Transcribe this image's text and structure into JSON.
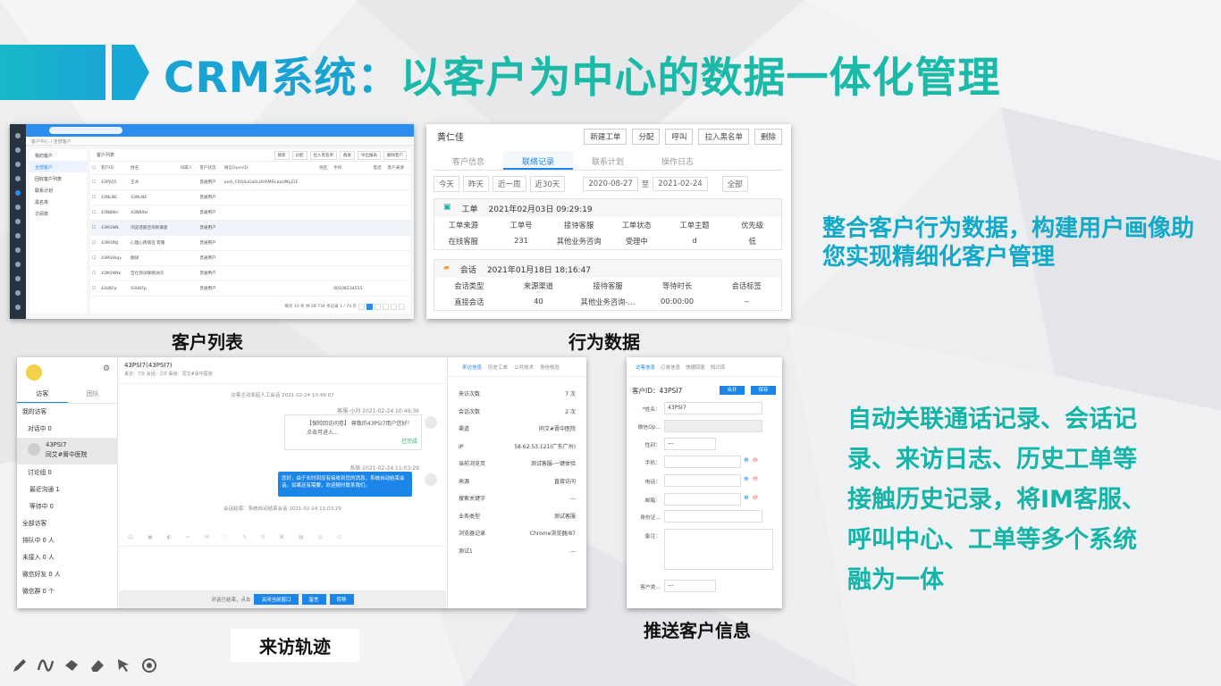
{
  "title": {
    "part1": "CRM系统：",
    "part2": "以客户为中心的数据一体化管理"
  },
  "right_text_1": "整合客户行为数据，构建用户画像助您实现精细化客户管理",
  "right_text_2": "自动关联通话记录、会话记录、来访日志、历史工单等接触历史记录，将IM客服、呼叫中心、工单等多个系统融为一体",
  "captions": {
    "customer_list": "客户列表",
    "behavior": "行为数据",
    "visit_track": "来访轨迹",
    "push_info": "推送客户信息"
  },
  "customer_list": {
    "breadcrumb": "客户中心 / 全部客户",
    "nav": [
      "我的客户",
      "全部客户",
      "回收客户列表",
      "联系计划",
      "黑名单",
      "订阅单"
    ],
    "list_title": "客户列表",
    "toolbar": [
      "搜索",
      "分配",
      "拉入黑名单",
      "群发",
      "导出报表",
      "删除客户"
    ],
    "columns": [
      "客户ID",
      "姓名",
      "归属人",
      "客户状态",
      "微信OpenID",
      "地区",
      "手机",
      "电话",
      "客户来源"
    ],
    "rows": [
      [
        "43PJVj5",
        "王水",
        "",
        "普通用户",
        "ozrh_F0Q4uGahLOHhMFicaaUfKyZrE",
        "",
        "",
        "",
        ""
      ],
      [
        "43NLNE",
        "43NLNE",
        "",
        "普通用户",
        "",
        "",
        "",
        "",
        ""
      ],
      [
        "43NB9kr",
        "43NB9kr",
        "",
        "普通用户",
        "",
        "",
        "",
        "",
        ""
      ],
      [
        "43M1NN",
        "浏览话题咨询到满意",
        "",
        "普通用户",
        "",
        "",
        "",
        "",
        ""
      ],
      [
        "43M1fNJ",
        "心理心疾病咨 客服",
        "",
        "普通用户",
        "",
        "",
        "",
        "",
        ""
      ],
      [
        "43M3Hlqv",
        "翻译",
        "",
        "普通用户",
        "",
        "",
        "",
        "",
        ""
      ],
      [
        "43M1NNk",
        "吉仕测试联络访问",
        "",
        "普通用户",
        "",
        "",
        "",
        "",
        ""
      ],
      [
        "43UKFp",
        "43UKFp",
        "",
        "普通用户",
        "",
        "",
        "00108234553",
        "",
        ""
      ]
    ],
    "pager": "每页 10 条 共 28 734 条记录  1 / 74 页"
  },
  "behavior": {
    "name": "黄仁佳",
    "buttons": [
      "新建工单",
      "分配",
      "呼叫",
      "拉入黑名单",
      "删除"
    ],
    "tabs": [
      "客户信息",
      "联络记录",
      "联系计划",
      "操作日志"
    ],
    "active_tab": "联络记录",
    "filters": [
      "今天",
      "昨天",
      "近一周",
      "近30天"
    ],
    "date_from": "2020-08-27",
    "date_sep": "至",
    "date_to": "2021-02-24",
    "scope": "全部",
    "card1": {
      "type": "工单",
      "time": "2021年02月03日 09:29:19",
      "headers": [
        "工单来源",
        "工单号",
        "接待客服",
        "工单状态",
        "工单主题",
        "优先级"
      ],
      "values": [
        "在线客服",
        "231",
        "其他业务咨询",
        "受理中",
        "d",
        "低"
      ]
    },
    "card2": {
      "type": "会话",
      "time": "2021年01月18日 18:16:47",
      "headers": [
        "会话类型",
        "来源渠道",
        "接待客服",
        "等待时长",
        "会话标签"
      ],
      "values": [
        "直接会话",
        "40",
        "其他业务咨询-...",
        "00:00:00",
        "--"
      ]
    }
  },
  "visit": {
    "tabs": [
      "访客",
      "团队"
    ],
    "list": [
      "我的访客",
      "对话中 0",
      "43PSI7\n同艾#膏中医院",
      "讨论组 0",
      "最近沟通 1",
      "等待中 0",
      "全部访客",
      "排队中 0 人",
      "未接入 0 人",
      "微信好友 0 人",
      "微信群 0 个"
    ],
    "header_title": "43PSI7(43PSI7)",
    "header_sub": "来访：7次 会话：2次 渠道：同艾#膏中医院",
    "sys1": "访客主动发起人工会话 2021-02-24 10:49:07",
    "who1": "客服-小刘  2021-02-24 10:49:36",
    "bubble1": "【保险回访问卷】 尊敬的43PSI7用户您好！点击可进入...",
    "bubble1_status": "已完成",
    "who2": "系统  2021-02-24 11:03:29",
    "bubble2": "您好，由于长时间没有接收到您的消息，系统自动结束会话。如果还有需要，欢迎随时联系我们。",
    "sys2": "会话结束：系统自动结束会话 2021-02-24 11:03:29",
    "tools": "☺ ▣ ◐ ✂ ✉ ♡ ✎ ⚲ ⌘ ▤ ◎ ⊙",
    "bottom": "对话已结束，点击",
    "bottom_btns": [
      "关闭当前窗口",
      "留言",
      "转移"
    ],
    "right_tabs": [
      "来访信息",
      "历史工单",
      "公共技术",
      "身份核验"
    ],
    "info": [
      [
        "来访次数",
        "7 次"
      ],
      [
        "会话次数",
        "2 次"
      ],
      [
        "渠道",
        "同艾#膏中医院"
      ],
      [
        "IP",
        "58.62.53.121(广东广州)"
      ],
      [
        "当前浏览页",
        "测试客服-一键体验"
      ],
      [
        "来源",
        "直接访问"
      ],
      [
        "搜索关键字",
        "---"
      ],
      [
        "业务类型",
        "测试客服"
      ],
      [
        "浏览器记录",
        "Chrome浏览器/87"
      ],
      [
        "测试1",
        "---"
      ]
    ]
  },
  "push": {
    "tabs": [
      "访客信息",
      "订单信息",
      "快捷回复",
      "知识库"
    ],
    "id_label": "客户ID：43PSI7",
    "btn_merge": "合并",
    "btn_save": "保存",
    "fields": [
      {
        "label": "*姓名：",
        "value": "43PSI7"
      },
      {
        "label": "微信Op...",
        "value": ""
      },
      {
        "label": "性别：",
        "value": "---"
      },
      {
        "label": "手机：",
        "value": ""
      },
      {
        "label": "电话：",
        "value": ""
      },
      {
        "label": "邮箱：",
        "value": ""
      },
      {
        "label": "身份证...",
        "value": ""
      },
      {
        "label": "备注：",
        "value": ""
      },
      {
        "label": "客户类...",
        "value": "---"
      }
    ]
  }
}
